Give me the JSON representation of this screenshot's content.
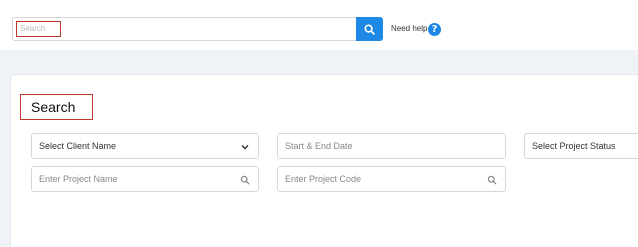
{
  "header": {
    "search_placeholder": "Search",
    "help_label": "Need help",
    "help_icon_glyph": "?",
    "accent_color": "#1e88e5"
  },
  "page": {
    "title": "Search"
  },
  "filters": {
    "client": {
      "value": "Select Client Name",
      "icon": "chevron-down-icon"
    },
    "date_range": {
      "placeholder": "Start & End Date"
    },
    "project_status": {
      "value": "Select Project Status"
    },
    "project_name": {
      "placeholder": "Enter Project Name",
      "icon": "search-icon"
    },
    "project_code": {
      "placeholder": "Enter Project Code",
      "icon": "search-icon"
    }
  }
}
